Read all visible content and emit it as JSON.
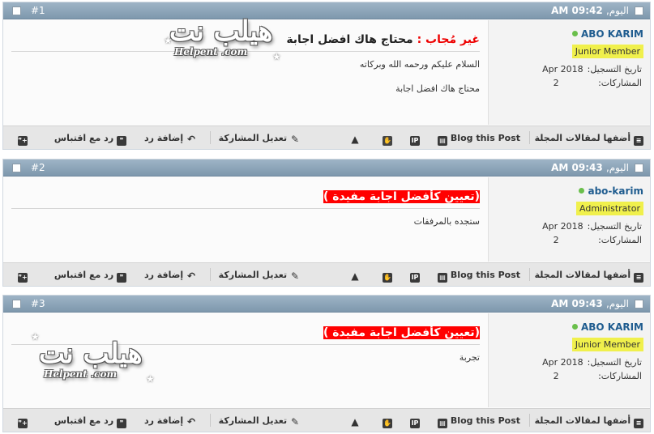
{
  "posts": [
    {
      "number": "#1",
      "date_label": "اليوم,",
      "time": "09:42 AM",
      "username": "ABO KARIM",
      "rank": "Junior Member",
      "reg_label": "تاريخ التسجيل:",
      "reg_value": "Apr 2018",
      "posts_label": "المشاركات:",
      "posts_value": "2",
      "title_prefix": "غير مُجاب :",
      "title": "محتاج هاك افضل اجابة",
      "lines": [
        "السلام عليكم ورحمه الله وبركاته",
        "محتاج هاك افضل اجابة"
      ]
    },
    {
      "number": "#2",
      "date_label": "اليوم,",
      "time": "09:43 AM",
      "username": "abo-karim",
      "rank": "Administrator",
      "reg_label": "تاريخ التسجيل:",
      "reg_value": "Apr 2018",
      "posts_label": "المشاركات:",
      "posts_value": "2",
      "title": "(تعيين كأفضل اجابة مفيدة )",
      "lines": [
        "ستجده بالمرفقات"
      ]
    },
    {
      "number": "#3",
      "date_label": "اليوم,",
      "time": "09:43 AM",
      "username": "ABO KARIM",
      "rank": "Junior Member",
      "reg_label": "تاريخ التسجيل:",
      "reg_value": "Apr 2018",
      "posts_label": "المشاركات:",
      "posts_value": "2",
      "title": "(تعيين كأفضل اجابة مفيدة )",
      "lines": [
        "تجربة‏‏‏‏‏‏‏‏‏‏‏‏‏‏‏‏‏‏‏‏‏‏‏‏‏‏‏‏‏‏‏‏‏‏‏‏‏‏‏‏‏‏‏‏"
      ]
    }
  ],
  "actions": {
    "add_to_articles": "أضفها لمقالات المجلة",
    "blog_this": "Blog this Post",
    "edit": "تعديل المشاركة",
    "reply": "إضافة رد",
    "quote_reply": "رد مع اقتباس"
  },
  "logo": {
    "arabic": "هيلب نت",
    "latin": "Helpent .com"
  },
  "icons": {
    "articles": "list-icon",
    "blog": "blog-icon",
    "ip": "ip-icon",
    "thanks": "thumbs-icon",
    "report": "warning-icon",
    "edit": "pencil-icon",
    "reply": "reply-icon",
    "quote": "quote-icon",
    "multiquote": "multiquote-icon"
  }
}
